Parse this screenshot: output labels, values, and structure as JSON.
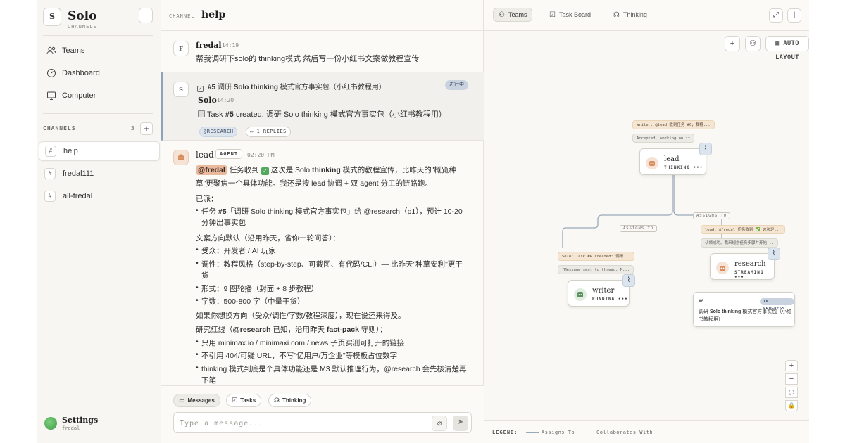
{
  "sidebar": {
    "brand_letter": "S",
    "brand_title": "Solo",
    "brand_sub": "CHANNELS",
    "nav": [
      {
        "label": "Teams",
        "icon": "users-icon"
      },
      {
        "label": "Dashboard",
        "icon": "gauge-icon"
      },
      {
        "label": "Computer",
        "icon": "monitor-icon"
      }
    ],
    "channels_label": "CHANNELS",
    "channels_count": "3",
    "channels": [
      {
        "label": "help",
        "active": true
      },
      {
        "label": "fredal111",
        "active": false
      },
      {
        "label": "all-fredal",
        "active": false
      }
    ],
    "settings_label": "Settings",
    "settings_user": "fredal"
  },
  "chat": {
    "channel_label": "CHANNEL",
    "channel_name": "help",
    "msg1": {
      "avatar": "F",
      "author": "fredal",
      "time": "14:19",
      "text": "帮我调研下solo的 thinking模式 然后写一份小红书文案做教程宣传"
    },
    "task": {
      "avatar": "S",
      "task_ref": "#5",
      "title_prefix": "调研 ",
      "title_bold": "Solo thinking",
      "title_rest": " 模式官方事实包（小红书教程用）",
      "status": "进行中",
      "author": "Solo",
      "time": "14:20",
      "created_text_1": "Task ",
      "created_ref": "#5",
      "created_text_2": " created: 调研 Solo thinking 模式官方事实包（小红书教程用）",
      "tag": "@RESEARCH",
      "replies": "1 REPLIES"
    },
    "lead": {
      "author": "lead",
      "tag": "AGENT",
      "time": "02:20 PM",
      "mention": "@fredal",
      "l1_a": " 任务收到 ",
      "l1_b": " 这次是 Solo ",
      "l1_bold": "thinking",
      "l1_c": " 模式的教程宣传，比昨天的\"概览种",
      "l2": "草\"更聚焦一个具体功能。我还是按 lead 协调 + 双 agent 分工的链路跑。",
      "dispatched": "已派：",
      "b1_a": "任务 ",
      "b1_ref": "#5",
      "b1_b": "「调研 Solo thinking 模式官方事实包」给 @research（p1），预计 10-20",
      "b1_c": "分钟出事实包",
      "direction": "文案方向默认（沿用昨天，省你一轮问答）：",
      "d1": "受众：开发者 / AI 玩家",
      "d2": "调性：教程风格（step-by-step、可截图、有代码/CLI）— 比昨天\"种草安利\"更干",
      "d2b": "货",
      "d3": "形式：9 图轮播（封面 + 8 步教程）",
      "d4": "字数：500-800 字（中量干货）",
      "change": "如果你想换方向（受众/调性/字数/教程深度），现在说还来得及。",
      "redline_a": "研究红线（",
      "redline_mention": "@research",
      "redline_b": " 已知，沿用昨天 ",
      "redline_bold": "fact-pack",
      "redline_c": " 守则）：",
      "r1": "只用 minimax.io / minimaxi.com / news 子页实测可打开的链接",
      "r2": "不引用 404/可疑 URL，不写\"亿用户/万企业\"等模板占位数字",
      "r3": "thinking 模式到底是个具体功能还是 M3 默认推理行为，@research 会先核清楚再",
      "r3b": "下笔"
    },
    "footer_tabs": [
      "Messages",
      "Tasks",
      "Thinking"
    ],
    "input_placeholder": "Type a message..."
  },
  "right": {
    "tabs": [
      "Teams",
      "Task Board",
      "Thinking"
    ],
    "auto_layout": "AUTO LAYOUT",
    "nodes": {
      "lead": {
        "name": "lead",
        "status": "THINKING •••"
      },
      "writer": {
        "name": "writer",
        "status": "RUNNING •••"
      },
      "research": {
        "name": "research",
        "status": "STREAMING •••"
      }
    },
    "bubbles": {
      "lead_warm": "writer: @lead 收到任务 #6，我将...",
      "lead_cool": "Accepted, working on it",
      "writer_warm": "Solo: Task #6 created: 调研...",
      "writer_cool": "\"Message sent to thread. M...",
      "research_warm": "lead: @fredal 任务收到 ✅ 这次是...",
      "research_cool": "认领成功。我来规划任务步骤并开始..."
    },
    "edge_labels": [
      "ASSIGNS TO",
      "ASSIGNS TO"
    ],
    "task_node": {
      "id": "#6",
      "badge": "IN PROGRESS",
      "title_a": "调研 ",
      "title_bold": "Solo thinking",
      "title_b": " 模式官方事实包（小红书教程用）"
    },
    "zoom": [
      "+",
      "−",
      "⛶",
      "🔒"
    ],
    "legend": {
      "title": "LEGEND:",
      "solid": "Assigns To",
      "dashed": "Collaborates With"
    }
  },
  "colors": {
    "accent": "#8fa3b8",
    "progress_badge": "#c9d3e0",
    "mention": "#e9b99e",
    "check": "#52a85d"
  }
}
